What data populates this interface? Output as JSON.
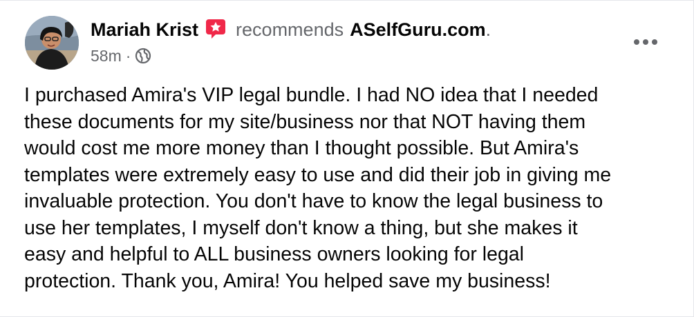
{
  "post": {
    "author": "Mariah Krist",
    "action": "recommends",
    "page": "ASelfGuru.com",
    "period": ".",
    "time": "58m",
    "separator": "·",
    "icons": {
      "badge": "recommendation-star-icon",
      "audience": "globe-icon",
      "menu": "more-options-icon"
    },
    "colors": {
      "badge": "#f02849",
      "secondary_text": "#65676b",
      "primary_text": "#050505"
    },
    "text": "I purchased Amira's VIP legal bundle. I had NO idea that I needed\nthese documents for my site/business nor that NOT having them\nwould cost me more money than I thought possible. But Amira's\ntemplates were extremely easy to use and did their job in giving me\ninvaluable protection. You don't have to know the legal business to\nuse her templates, I myself don't know a thing, but she makes it\neasy and helpful to ALL business owners looking for legal\nprotection. Thank you, Amira! You helped save my business!"
  }
}
